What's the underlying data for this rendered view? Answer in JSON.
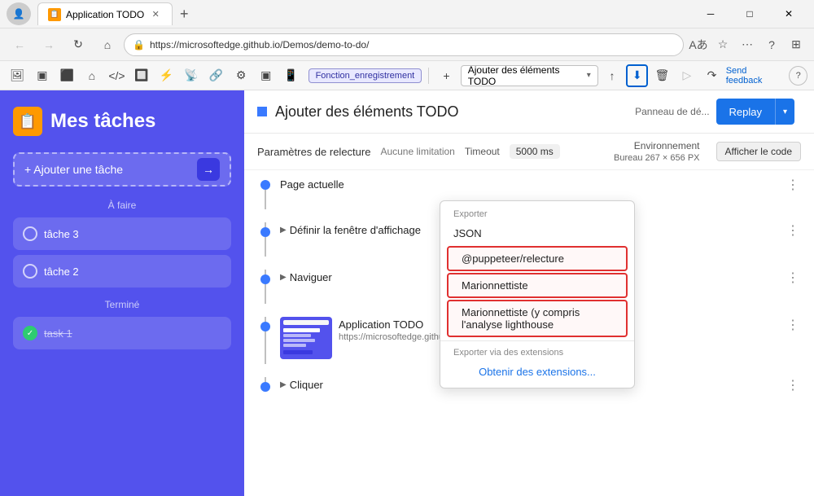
{
  "browser": {
    "tab_title": "Application TODO",
    "tab_icon": "📋",
    "address": "https://microsoftedge.github.io/Demos/demo-to-do/",
    "new_tab_icon": "+",
    "profile_initial": "👤",
    "win_minimize": "─",
    "win_restore": "□",
    "win_close": "✕"
  },
  "toolbar": {
    "recording_label": "Ajouter des éléments TODO",
    "function_badge": "Fonction_enregistrement",
    "send_feedback": "Send feedback",
    "question_mark": "?"
  },
  "todo_app": {
    "icon": "📋",
    "title": "Mes tâches",
    "add_button": "+ Ajouter une tâche",
    "section_todo": "À faire",
    "task1": "tâche 3",
    "task2": "tâche 2",
    "section_done": "Terminé",
    "task_done": "task 1"
  },
  "recording": {
    "title": "Ajouter des éléments TODO",
    "dot_color": "#3a7aff",
    "panneau_label": "Panneau de dé...",
    "replay_label": "Replay",
    "settings_label": "Paramètres de relecture",
    "no_limit": "Aucune limitation",
    "timeout_label": "Timeout",
    "timeout_value": "5000 ms",
    "env_title": "Environnement",
    "env_value": "Bureau 267 × 656 PX",
    "show_code": "Afficher le code"
  },
  "dropdown": {
    "export_label": "Exporter",
    "json_item": "JSON",
    "puppeteer_item": "@puppeteer/relecture",
    "marionnettiste_item": "Marionnettiste",
    "marionnettiste_lighthouse": "Marionnettiste (y compris l'analyse lighthouse",
    "extensions_label": "Exporter via des extensions",
    "get_extensions": "Obtenir des extensions..."
  },
  "steps": [
    {
      "id": 1,
      "title": "Page actuelle",
      "subtitle": "",
      "has_thumb": false,
      "has_expand": false
    },
    {
      "id": 2,
      "title": "Définir la fenêtre d'affichage",
      "subtitle": "",
      "has_thumb": false,
      "has_expand": true,
      "expand_caret": "▶"
    },
    {
      "id": 3,
      "title": "Naviguer",
      "subtitle": "",
      "has_thumb": false,
      "has_expand": true,
      "expand_caret": "▶"
    },
    {
      "id": 4,
      "title": "Application TODO",
      "subtitle": "https://microsoftedge.github.io/Demos/demo-to-do/",
      "has_thumb": true,
      "has_expand": false
    },
    {
      "id": 5,
      "title": "Cliquer",
      "subtitle": "",
      "has_thumb": false,
      "has_expand": true,
      "expand_caret": "▶"
    }
  ],
  "icons": {
    "back": "←",
    "forward": "→",
    "refresh": "↻",
    "home": "⌂",
    "lock": "🔒",
    "favorites": "☆",
    "more": "⋯",
    "help": "?",
    "close": "✕",
    "add": "+",
    "upload": "⬆",
    "delete": "🗑",
    "play": "▷",
    "redo": "↷",
    "record": "⏺",
    "screenshot": "📷",
    "device": "📱",
    "lightning": "⚡",
    "wifi": "📡",
    "link": "🔗",
    "gear": "⚙",
    "tab_icon": "▣",
    "extend": "⊞",
    "cursor": "✦",
    "three_dots": "⋮",
    "chevron_down": "▾",
    "chevron_right": "▶"
  }
}
